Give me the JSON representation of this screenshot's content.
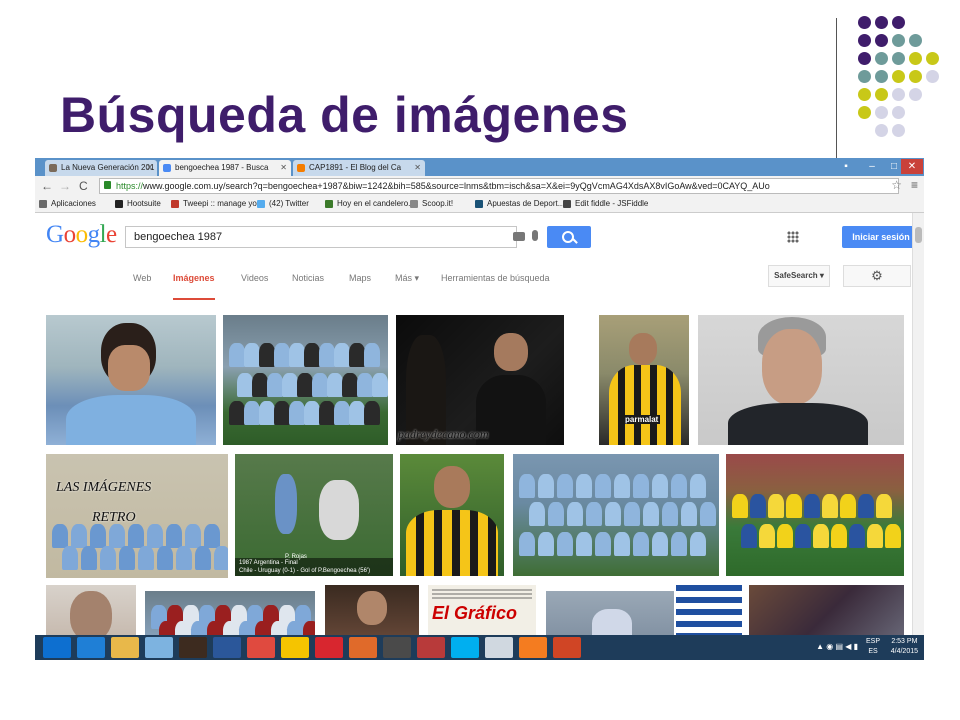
{
  "slide": {
    "title": "Búsqueda de imágenes",
    "accent": "#3f1d6b",
    "dot_colors": [
      "#3f1d6b",
      "#6e9b9a",
      "#c8c818",
      "#d4d4e6"
    ]
  },
  "browser": {
    "tabs": [
      {
        "label": "La Nueva Generación 201",
        "icon": "generic-page-icon",
        "active": false
      },
      {
        "label": "bengoechea 1987 - Busca",
        "icon": "google-g-icon",
        "active": true
      },
      {
        "label": "CAP1891 - El Blog del Ca",
        "icon": "blogger-icon",
        "active": false
      }
    ],
    "window_buttons": [
      "–",
      "□",
      "✕"
    ],
    "url_scheme": "https://",
    "url_rest": "www.google.com.uy/search?q=bengoechea+1987&biw=1242&bih=585&source=lnms&tbm=isch&sa=X&ei=9yQgVcmAG4XdsAX8vIGoAw&ved=0CAYQ_AUo",
    "nav": {
      "back": "←",
      "forward": "→",
      "reload": "C"
    },
    "bookmarks": [
      {
        "label": "Aplicaciones",
        "icon": "apps-grid-icon",
        "color": "#6a6a6a"
      },
      {
        "label": "Hootsuite",
        "icon": "hootsuite-owl-icon",
        "color": "#222222"
      },
      {
        "label": "Tweepi :: manage yo...",
        "icon": "tweepi-icon",
        "color": "#c0392b"
      },
      {
        "label": "(42) Twitter",
        "icon": "twitter-bird-icon",
        "color": "#55acee"
      },
      {
        "label": "Hoy en el candelero...",
        "icon": "bookmark-icon",
        "color": "#3b7a2a"
      },
      {
        "label": "Scoop.it!",
        "icon": "scoopit-icon",
        "color": "#888888"
      },
      {
        "label": "Apuestas de Deport...",
        "icon": "betting-icon",
        "color": "#1a5276"
      },
      {
        "label": "Edit fiddle - JSFiddle",
        "icon": "jsfiddle-cloud-icon",
        "color": "#444444"
      }
    ]
  },
  "google": {
    "logo": "Google",
    "logo_colors": [
      "#4285f4",
      "#ea4335",
      "#fbbc05",
      "#4285f4",
      "#34a853",
      "#ea4335"
    ],
    "query": "bengoechea 1987",
    "signin": "Iniciar sesión",
    "tabs": [
      "Web",
      "Imágenes",
      "Videos",
      "Noticias",
      "Maps",
      "Más ▾",
      "Herramientas de búsqueda"
    ],
    "active_tab": "Imágenes",
    "safesearch": "SafeSearch ▾",
    "settings_icon": "⚙"
  },
  "images": {
    "watermark_1": "padreydecano.com",
    "sponsor": "parmalat",
    "overlay_title": "LAS IMÁGENES",
    "overlay_sub": "RETRO",
    "brand_puma": "PUMA",
    "caption_ptag": "P. Rojas",
    "caption_small": "1987 Argentina - Final",
    "caption_small2": "Chile - Uruguay (0-1) - Gol of P.Bengoechea (56')",
    "magazine": "El Gráfico"
  },
  "taskbar": {
    "apps": [
      {
        "name": "dropbox-icon",
        "color": "#0d6fd0"
      },
      {
        "name": "internet-explorer-icon",
        "color": "#1f7fd6"
      },
      {
        "name": "file-explorer-icon",
        "color": "#e8b84a"
      },
      {
        "name": "app-window-icon",
        "color": "#7db3e0"
      },
      {
        "name": "media-player-icon",
        "color": "#3d2b1f"
      },
      {
        "name": "word-icon",
        "color": "#2b579a"
      },
      {
        "name": "chrome-icon",
        "color": "#e04a3f"
      },
      {
        "name": "norton-icon",
        "color": "#f5c400"
      },
      {
        "name": "r-app-icon",
        "color": "#d8262f"
      },
      {
        "name": "color-app-icon",
        "color": "#e06a2a"
      },
      {
        "name": "film-strip-icon",
        "color": "#4a4a4a"
      },
      {
        "name": "ball-icon",
        "color": "#b83a3a"
      },
      {
        "name": "skype-icon",
        "color": "#00aff0"
      },
      {
        "name": "paint-icon",
        "color": "#d0d8e0"
      },
      {
        "name": "avast-icon",
        "color": "#f47c20"
      },
      {
        "name": "powerpoint-icon",
        "color": "#d04525"
      }
    ],
    "lang": "ESP",
    "lang2": "ES",
    "time": "2:53 PM",
    "date": "4/4/2015",
    "tray_icons": "▲ ◉ ▤ ◀ ▮"
  }
}
